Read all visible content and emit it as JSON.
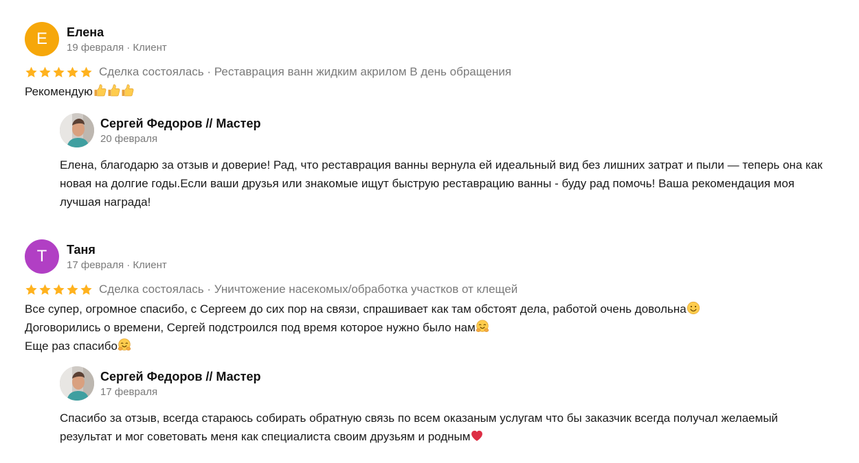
{
  "reviews": [
    {
      "author": "Елена",
      "initial": "Е",
      "avatar_color": "#f6a70a",
      "date": "19 февраля",
      "role": "Клиент",
      "rating": 5,
      "status": "Сделка состоялась",
      "service": "Реставрация ванн жидким акрилом В день обращения",
      "text_lines": [
        "Рекомендую"
      ],
      "emojis": [
        "thumbs-up",
        "thumbs-up",
        "thumbs-up"
      ],
      "reply": {
        "author": "Сергей Федоров // Мастер",
        "date": "20 февраля",
        "text": "Елена, благодарю за отзыв и доверие! Рад, что реставрация ванны вернула ей идеальный вид без лишних затрат и пыли — теперь она как новая на долгие годы.Если ваши друзья или знакомые ищут быструю реставрацию ванны - буду рад помочь! Ваша рекомендация моя лучшая награда!"
      }
    },
    {
      "author": "Таня",
      "initial": "Т",
      "avatar_color": "#b13fc4",
      "date": "17 февраля",
      "role": "Клиент",
      "rating": 5,
      "status": "Сделка состоялась",
      "service": "Уничтожение насекомых/обработка участков от клещей",
      "text_lines": [
        "Все супер, огромное спасибо, с Сергеем до сих пор на связи, спрашивает как там обстоят дела, работой очень довольна",
        "Договорились о времени, Сергей подстроился под время которое нужно было нам",
        "Еще раз спасибо"
      ],
      "line_emojis": [
        "slightly-smiling-face",
        "hugging-face",
        "hugging-face"
      ],
      "reply": {
        "author": "Сергей Федоров // Мастер",
        "date": "17 февраля",
        "text": "Спасибо за отзыв, всегда стараюсь собирать обратную связь по всем оказаным услугам что бы заказчик всегда получал желаемый результат и мог советовать меня как специалиста своим друзьям и родным",
        "emoji": "red-heart"
      }
    }
  ],
  "colors": {
    "star": "#ffb21e",
    "muted_text": "#7a7a7a"
  },
  "separator": "·"
}
